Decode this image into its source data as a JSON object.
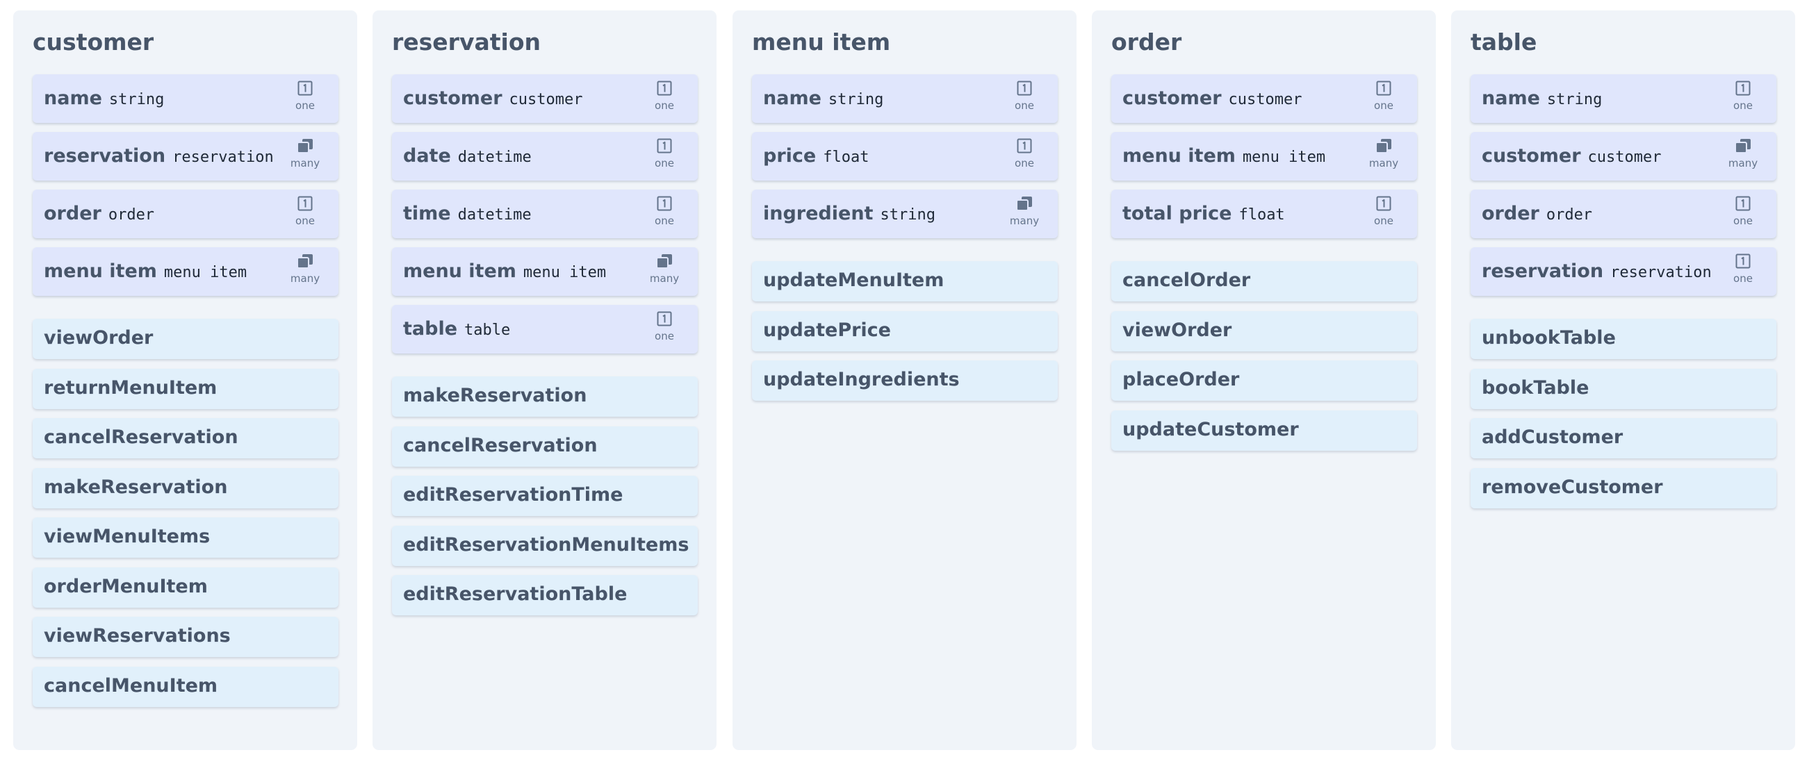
{
  "entities": [
    {
      "name": "customer",
      "fields": [
        {
          "name": "name",
          "type": "string",
          "cardinality": "one"
        },
        {
          "name": "reservation",
          "type": "reservation",
          "cardinality": "many"
        },
        {
          "name": "order",
          "type": "order",
          "cardinality": "one"
        },
        {
          "name": "menu item",
          "type": "menu item",
          "cardinality": "many"
        }
      ],
      "methods": [
        "viewOrder",
        "returnMenuItem",
        "cancelReservation",
        "makeReservation",
        "viewMenuItems",
        "orderMenuItem",
        "viewReservations",
        "cancelMenuItem"
      ]
    },
    {
      "name": "reservation",
      "fields": [
        {
          "name": "customer",
          "type": "customer",
          "cardinality": "one"
        },
        {
          "name": "date",
          "type": "datetime",
          "cardinality": "one"
        },
        {
          "name": "time",
          "type": "datetime",
          "cardinality": "one"
        },
        {
          "name": "menu item",
          "type": "menu item",
          "cardinality": "many"
        },
        {
          "name": "table",
          "type": "table",
          "cardinality": "one"
        }
      ],
      "methods": [
        "makeReservation",
        "cancelReservation",
        "editReservationTime",
        "editReservationMenuItems",
        "editReservationTable"
      ]
    },
    {
      "name": "menu item",
      "fields": [
        {
          "name": "name",
          "type": "string",
          "cardinality": "one"
        },
        {
          "name": "price",
          "type": "float",
          "cardinality": "one"
        },
        {
          "name": "ingredient",
          "type": "string",
          "cardinality": "many"
        }
      ],
      "methods": [
        "updateMenuItem",
        "updatePrice",
        "updateIngredients"
      ]
    },
    {
      "name": "order",
      "fields": [
        {
          "name": "customer",
          "type": "customer",
          "cardinality": "one"
        },
        {
          "name": "menu item",
          "type": "menu item",
          "cardinality": "many"
        },
        {
          "name": "total price",
          "type": "float",
          "cardinality": "one"
        }
      ],
      "methods": [
        "cancelOrder",
        "viewOrder",
        "placeOrder",
        "updateCustomer"
      ]
    },
    {
      "name": "table",
      "fields": [
        {
          "name": "name",
          "type": "string",
          "cardinality": "one"
        },
        {
          "name": "customer",
          "type": "customer",
          "cardinality": "many"
        },
        {
          "name": "order",
          "type": "order",
          "cardinality": "one"
        },
        {
          "name": "reservation",
          "type": "reservation",
          "cardinality": "one"
        }
      ],
      "methods": [
        "unbookTable",
        "bookTable",
        "addCustomer",
        "removeCustomer"
      ]
    }
  ],
  "icons": {
    "one": "single-box-icon",
    "many": "stacked-boxes-icon"
  },
  "colors": {
    "panel": "#f0f4f9",
    "field": "#e0e6fc",
    "method": "#e1f0fb",
    "text": "#475569"
  }
}
